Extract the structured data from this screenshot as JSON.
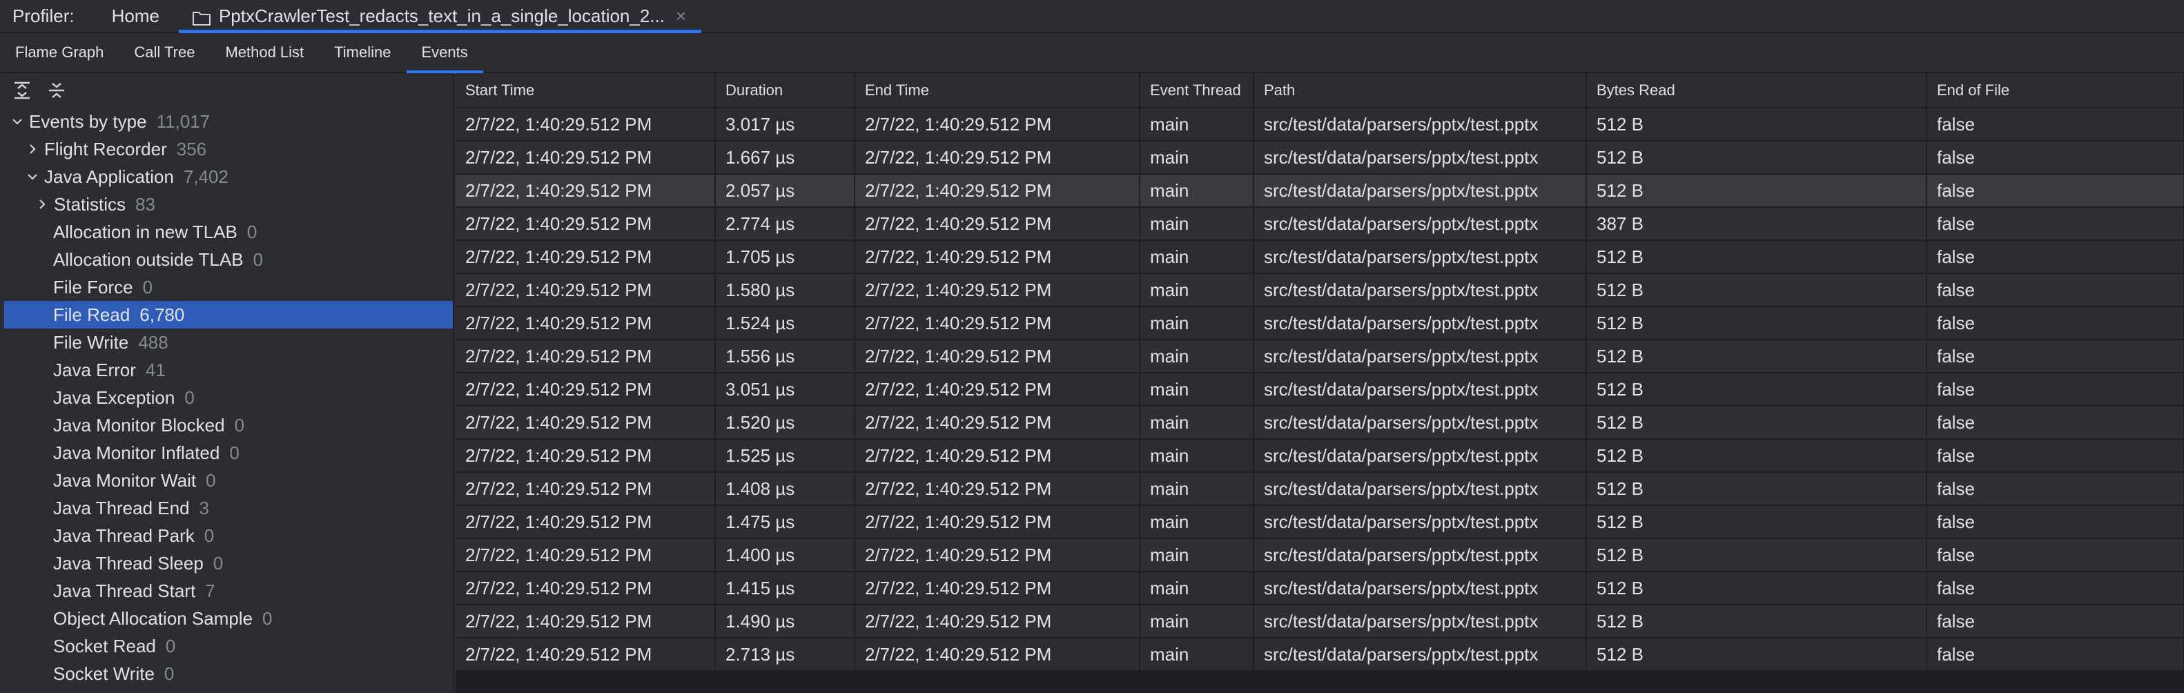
{
  "header": {
    "profiler_label": "Profiler:",
    "home_tab": "Home",
    "file_tab": "PptxCrawlerTest_redacts_text_in_a_single_location_2...",
    "close_glyph": "×"
  },
  "subtabs": [
    "Flame Graph",
    "Call Tree",
    "Method List",
    "Timeline",
    "Events"
  ],
  "active_subtab": "Events",
  "tree": [
    {
      "label": "Events by type",
      "count": "11,017",
      "level": 0,
      "chevron": "down"
    },
    {
      "label": "Flight Recorder",
      "count": "356",
      "level": 1,
      "chevron": "right"
    },
    {
      "label": "Java Application",
      "count": "7,402",
      "level": 1,
      "chevron": "down"
    },
    {
      "label": "Statistics",
      "count": "83",
      "level": 2,
      "chevron": "right"
    },
    {
      "label": "Allocation in new TLAB",
      "count": "0",
      "level": 3
    },
    {
      "label": "Allocation outside TLAB",
      "count": "0",
      "level": 3
    },
    {
      "label": "File Force",
      "count": "0",
      "level": 3
    },
    {
      "label": "File Read",
      "count": "6,780",
      "level": 3,
      "selected": true
    },
    {
      "label": "File Write",
      "count": "488",
      "level": 3
    },
    {
      "label": "Java Error",
      "count": "41",
      "level": 3
    },
    {
      "label": "Java Exception",
      "count": "0",
      "level": 3
    },
    {
      "label": "Java Monitor Blocked",
      "count": "0",
      "level": 3
    },
    {
      "label": "Java Monitor Inflated",
      "count": "0",
      "level": 3
    },
    {
      "label": "Java Monitor Wait",
      "count": "0",
      "level": 3
    },
    {
      "label": "Java Thread End",
      "count": "3",
      "level": 3
    },
    {
      "label": "Java Thread Park",
      "count": "0",
      "level": 3
    },
    {
      "label": "Java Thread Sleep",
      "count": "0",
      "level": 3
    },
    {
      "label": "Java Thread Start",
      "count": "7",
      "level": 3
    },
    {
      "label": "Object Allocation Sample",
      "count": "0",
      "level": 3
    },
    {
      "label": "Socket Read",
      "count": "0",
      "level": 3
    },
    {
      "label": "Socket Write",
      "count": "0",
      "level": 3
    }
  ],
  "table": {
    "columns": [
      "Start Time",
      "Duration",
      "End Time",
      "Event Thread",
      "Path",
      "Bytes Read",
      "End of File"
    ],
    "rows": [
      [
        "2/7/22, 1:40:29.512 PM",
        "3.017 µs",
        "2/7/22, 1:40:29.512 PM",
        "main",
        "src/test/data/parsers/pptx/test.pptx",
        "512 B",
        "false"
      ],
      [
        "2/7/22, 1:40:29.512 PM",
        "1.667 µs",
        "2/7/22, 1:40:29.512 PM",
        "main",
        "src/test/data/parsers/pptx/test.pptx",
        "512 B",
        "false"
      ],
      [
        "2/7/22, 1:40:29.512 PM",
        "2.057 µs",
        "2/7/22, 1:40:29.512 PM",
        "main",
        "src/test/data/parsers/pptx/test.pptx",
        "512 B",
        "false"
      ],
      [
        "2/7/22, 1:40:29.512 PM",
        "2.774 µs",
        "2/7/22, 1:40:29.512 PM",
        "main",
        "src/test/data/parsers/pptx/test.pptx",
        "387 B",
        "false"
      ],
      [
        "2/7/22, 1:40:29.512 PM",
        "1.705 µs",
        "2/7/22, 1:40:29.512 PM",
        "main",
        "src/test/data/parsers/pptx/test.pptx",
        "512 B",
        "false"
      ],
      [
        "2/7/22, 1:40:29.512 PM",
        "1.580 µs",
        "2/7/22, 1:40:29.512 PM",
        "main",
        "src/test/data/parsers/pptx/test.pptx",
        "512 B",
        "false"
      ],
      [
        "2/7/22, 1:40:29.512 PM",
        "1.524 µs",
        "2/7/22, 1:40:29.512 PM",
        "main",
        "src/test/data/parsers/pptx/test.pptx",
        "512 B",
        "false"
      ],
      [
        "2/7/22, 1:40:29.512 PM",
        "1.556 µs",
        "2/7/22, 1:40:29.512 PM",
        "main",
        "src/test/data/parsers/pptx/test.pptx",
        "512 B",
        "false"
      ],
      [
        "2/7/22, 1:40:29.512 PM",
        "3.051 µs",
        "2/7/22, 1:40:29.512 PM",
        "main",
        "src/test/data/parsers/pptx/test.pptx",
        "512 B",
        "false"
      ],
      [
        "2/7/22, 1:40:29.512 PM",
        "1.520 µs",
        "2/7/22, 1:40:29.512 PM",
        "main",
        "src/test/data/parsers/pptx/test.pptx",
        "512 B",
        "false"
      ],
      [
        "2/7/22, 1:40:29.512 PM",
        "1.525 µs",
        "2/7/22, 1:40:29.512 PM",
        "main",
        "src/test/data/parsers/pptx/test.pptx",
        "512 B",
        "false"
      ],
      [
        "2/7/22, 1:40:29.512 PM",
        "1.408 µs",
        "2/7/22, 1:40:29.512 PM",
        "main",
        "src/test/data/parsers/pptx/test.pptx",
        "512 B",
        "false"
      ],
      [
        "2/7/22, 1:40:29.512 PM",
        "1.475 µs",
        "2/7/22, 1:40:29.512 PM",
        "main",
        "src/test/data/parsers/pptx/test.pptx",
        "512 B",
        "false"
      ],
      [
        "2/7/22, 1:40:29.512 PM",
        "1.400 µs",
        "2/7/22, 1:40:29.512 PM",
        "main",
        "src/test/data/parsers/pptx/test.pptx",
        "512 B",
        "false"
      ],
      [
        "2/7/22, 1:40:29.512 PM",
        "1.415 µs",
        "2/7/22, 1:40:29.512 PM",
        "main",
        "src/test/data/parsers/pptx/test.pptx",
        "512 B",
        "false"
      ],
      [
        "2/7/22, 1:40:29.512 PM",
        "1.490 µs",
        "2/7/22, 1:40:29.512 PM",
        "main",
        "src/test/data/parsers/pptx/test.pptx",
        "512 B",
        "false"
      ],
      [
        "2/7/22, 1:40:29.512 PM",
        "2.713 µs",
        "2/7/22, 1:40:29.512 PM",
        "main",
        "src/test/data/parsers/pptx/test.pptx",
        "512 B",
        "false"
      ]
    ],
    "highlighted_row": 2
  },
  "icons": {
    "tab_file": "folder-icon",
    "tree_expand": "expand-all-icon",
    "tree_collapse": "collapse-all-icon"
  },
  "colors": {
    "accent": "#3574f0",
    "selection": "#2e5cb8",
    "background": "#2b2d30"
  }
}
